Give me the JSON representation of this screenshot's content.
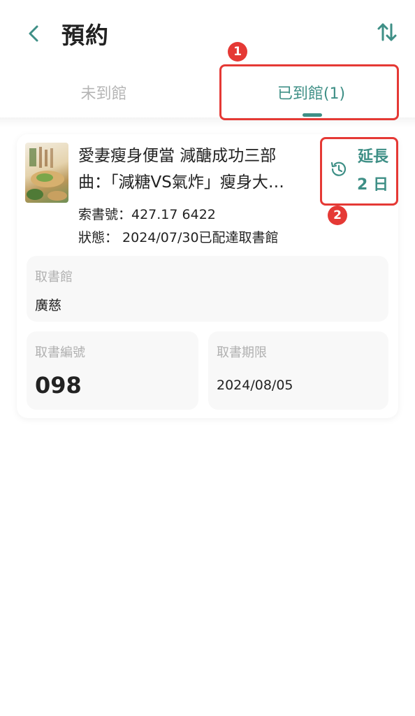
{
  "header": {
    "title": "預約",
    "back_icon": "chevron-left-icon",
    "sort_icon": "sort-arrows-icon"
  },
  "tabs": [
    {
      "label": "未到館",
      "active": false
    },
    {
      "label": "已到館(1)",
      "active": true
    }
  ],
  "annotations": [
    {
      "number": "1"
    },
    {
      "number": "2"
    }
  ],
  "reservation": {
    "title_line1": "愛妻瘦身便當 減醣成功三部",
    "title_line2": "曲：「減糖VS氣炸」瘦身大…",
    "call_number": "索書號：427.17 6422",
    "status": "狀態： 2024/07/30已配達取書館",
    "extend_label": "延長",
    "extend_days": "2 日",
    "pickup_library_label": "取書館",
    "pickup_library": "廣慈",
    "pickup_code_label": "取書編號",
    "pickup_code": "098",
    "pickup_deadline_label": "取書期限",
    "pickup_deadline": "2024/08/05"
  },
  "colors": {
    "accent": "#3e8f86",
    "annotation": "#e53935",
    "muted": "#b0b0b0"
  }
}
